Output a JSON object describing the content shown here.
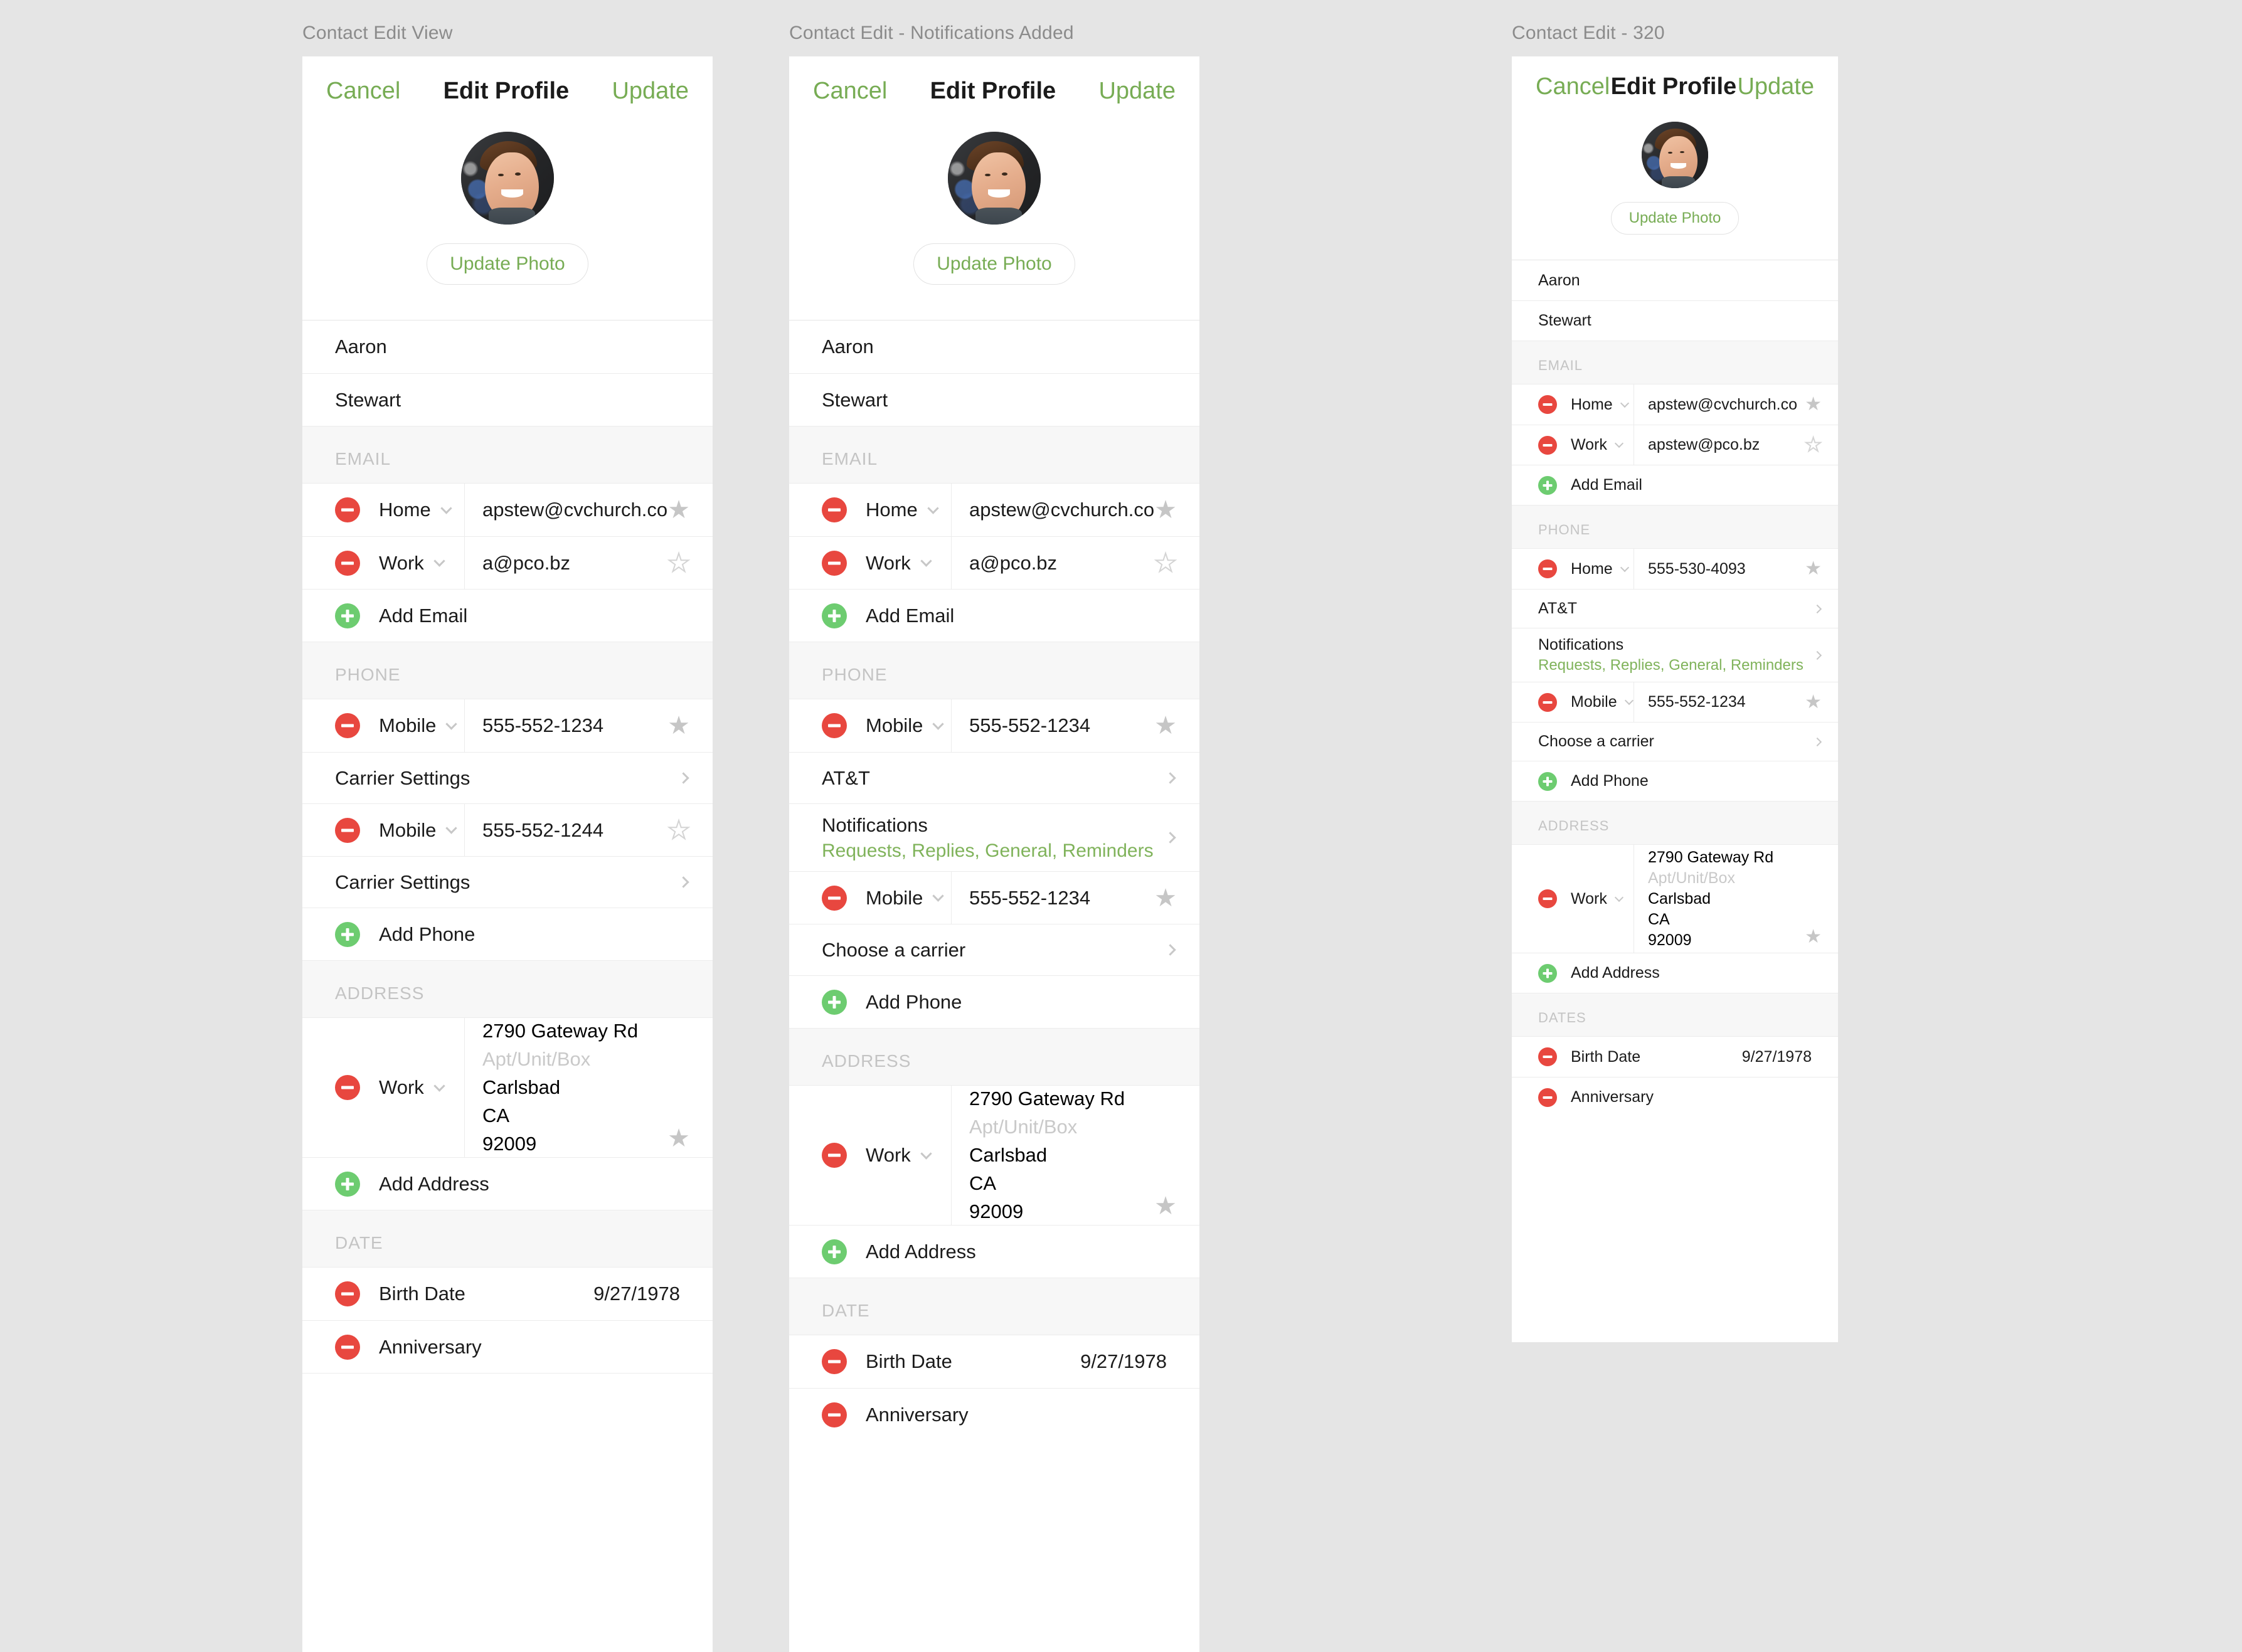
{
  "frames": [
    {
      "label": "Contact Edit  View",
      "nav": {
        "cancel": "Cancel",
        "title": "Edit Profile",
        "update": "Update"
      },
      "avatar": {
        "update_photo": "Update Photo"
      },
      "name": {
        "first": "Aaron",
        "last": "Stewart"
      },
      "email": {
        "header": "EMAIL",
        "rows": [
          {
            "type": "Home",
            "value": "apstew@cvchurch.co",
            "primary": true
          },
          {
            "type": "Work",
            "value": "a@pco.bz",
            "primary": false
          }
        ],
        "add": "Add Email"
      },
      "phone": {
        "header": "PHONE",
        "rows": [
          {
            "type": "Mobile",
            "value": "555-552-1234",
            "primary": true,
            "carrier": "Carrier Settings"
          },
          {
            "type": "Mobile",
            "value": "555-552-1244",
            "primary": false,
            "carrier": "Carrier Settings"
          }
        ],
        "add": "Add Phone"
      },
      "address": {
        "header": "ADDRESS",
        "type": "Work",
        "street": "2790 Gateway Rd",
        "apt_placeholder": "Apt/Unit/Box",
        "city": "Carlsbad",
        "state": "CA",
        "zip": "92009",
        "primary": true,
        "add": "Add Address"
      },
      "date": {
        "header": "DATE",
        "birth_label": "Birth Date",
        "birth_value": "9/27/1978",
        "anniversary_label": "Anniversary"
      }
    },
    {
      "label": "Contact Edit - Notifications Added",
      "nav": {
        "cancel": "Cancel",
        "title": "Edit Profile",
        "update": "Update"
      },
      "avatar": {
        "update_photo": "Update Photo"
      },
      "name": {
        "first": "Aaron",
        "last": "Stewart"
      },
      "email": {
        "header": "EMAIL",
        "rows": [
          {
            "type": "Home",
            "value": "apstew@cvchurch.co",
            "primary": true
          },
          {
            "type": "Work",
            "value": "a@pco.bz",
            "primary": false
          }
        ],
        "add": "Add Email"
      },
      "phone": {
        "header": "PHONE",
        "row1": {
          "type": "Mobile",
          "value": "555-552-1234",
          "primary": true
        },
        "carrier1": "AT&T",
        "notifications_label": "Notifications",
        "notifications_value": "Requests, Replies, General, Reminders",
        "row2": {
          "type": "Mobile",
          "value": "555-552-1234",
          "primary": true
        },
        "carrier2": "Choose a carrier",
        "add": "Add Phone"
      },
      "address": {
        "header": "ADDRESS",
        "type": "Work",
        "street": "2790 Gateway Rd",
        "apt_placeholder": "Apt/Unit/Box",
        "city": "Carlsbad",
        "state": "CA",
        "zip": "92009",
        "primary": true,
        "add": "Add Address"
      },
      "date": {
        "header": "DATE",
        "birth_label": "Birth Date",
        "birth_value": "9/27/1978",
        "anniversary_label": "Anniversary"
      }
    },
    {
      "label": "Contact Edit - 320",
      "nav": {
        "cancel": "Cancel",
        "title": "Edit Profile",
        "update": "Update"
      },
      "avatar": {
        "update_photo": "Update Photo"
      },
      "name": {
        "first": "Aaron",
        "last": "Stewart"
      },
      "email": {
        "header": "EMAIL",
        "rows": [
          {
            "type": "Home",
            "value": "apstew@cvchurch.co",
            "primary": true
          },
          {
            "type": "Work",
            "value": "apstew@pco.bz",
            "primary": false
          }
        ],
        "add": "Add Email"
      },
      "phone": {
        "header": "PHONE",
        "row1": {
          "type": "Home",
          "value": "555-530-4093",
          "primary": true
        },
        "carrier1": "AT&T",
        "notifications_label": "Notifications",
        "notifications_value": "Requests, Replies, General, Reminders",
        "row2": {
          "type": "Mobile",
          "value": "555-552-1234",
          "primary": true
        },
        "carrier2": "Choose a carrier",
        "add": "Add Phone"
      },
      "address": {
        "header": "ADDRESS",
        "type": "Work",
        "street": "2790 Gateway Rd",
        "apt_placeholder": "Apt/Unit/Box",
        "city": "Carlsbad",
        "state": "CA",
        "zip": "92009",
        "primary": true,
        "add": "Add Address"
      },
      "date": {
        "header": "DATES",
        "birth_label": "Birth Date",
        "birth_value": "9/27/1978",
        "anniversary_label": "Anniversary"
      }
    }
  ],
  "colors": {
    "accent_green": "#77ac54",
    "notif_green": "#80b35b",
    "remove_red": "#e8473f",
    "add_green": "#6dcc70",
    "canvas": "#e5e5e5",
    "section_bg": "#f7f7f7",
    "star_filled": "#c6c6c6"
  },
  "icons": {
    "star_filled": "★",
    "star_hollow": "★"
  }
}
